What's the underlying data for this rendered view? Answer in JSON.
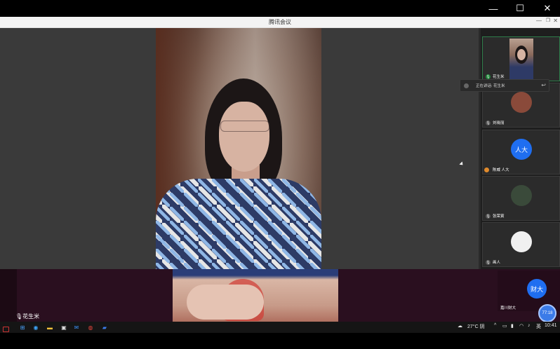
{
  "window": {
    "title": "腾讯会议",
    "controls": {
      "minimize": "—",
      "maximize": "☐",
      "close": "✕"
    }
  },
  "speaking": {
    "label": "正在讲话: 花生米"
  },
  "participants": [
    {
      "name": "花生米",
      "type": "video"
    },
    {
      "name": "刘晓丽",
      "type": "avatar",
      "color": "#8a4a3a"
    },
    {
      "name": "陈威 人大",
      "type": "initials",
      "initials": "人大",
      "color": "#1f6ef0"
    },
    {
      "name": "张荣寅",
      "type": "avatar",
      "color": "#3a4a3a"
    },
    {
      "name": "画人",
      "type": "avatar",
      "color": "#f0f0f0"
    }
  ],
  "bottom": {
    "self_name": "花生米",
    "corner": {
      "name": "嘉川财大",
      "initials": "财大"
    },
    "bubble": "77:18"
  },
  "taskbar": {
    "weather": "27°C 阴",
    "ime": "英",
    "time": "10:41"
  }
}
